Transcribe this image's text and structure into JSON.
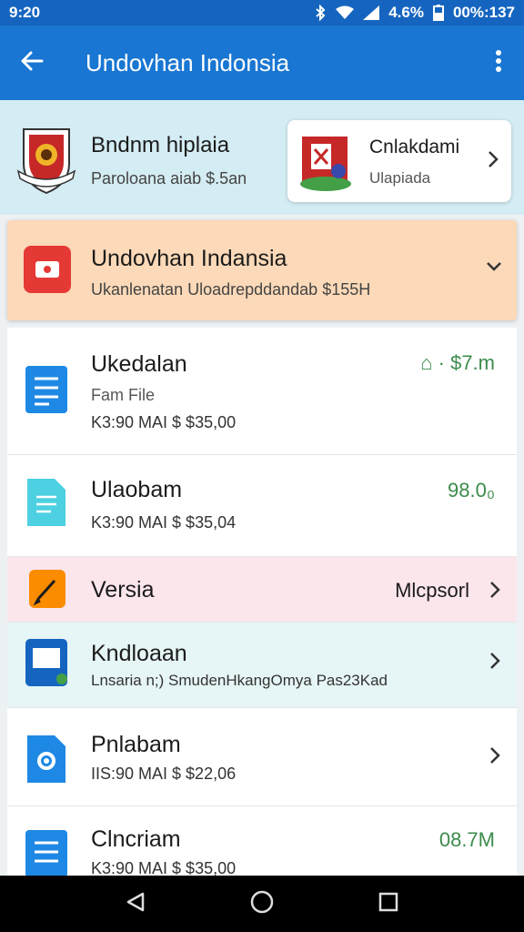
{
  "status": {
    "time": "9:20",
    "battery": "4.6%",
    "extra": "00%:137"
  },
  "app_bar": {
    "title": "Undovhan Indonsia"
  },
  "banner": {
    "title": "Bndnm hiplaia",
    "subtitle": "Paroloana aiab $.5an",
    "chip": {
      "title": "Cnlakdami",
      "subtitle": "Ulapiada"
    }
  },
  "highlight": {
    "title": "Undovhan Indansia",
    "subtitle": "Ukanlenatan Uloadrepddandab $155H"
  },
  "rows": [
    {
      "title": "Ukedalan",
      "sub": "Fam File",
      "sub2": "K3:90 MAI $ $35,00",
      "value": "⌂ · $7.m"
    },
    {
      "title": "Ulaobam",
      "sub": "K3:90 MAI $ $35,04",
      "value": "98.0₀"
    },
    {
      "title": "Versia",
      "value_text": "Mlcpsorl"
    },
    {
      "title": "Kndloaan",
      "sub": "Lnsaria n;) SmudenHkangOmya Pas23Kad"
    },
    {
      "title": "Pnlabam",
      "sub": "IIS:90 MAI $ $22,06"
    },
    {
      "title": "Clncriam",
      "sub": "K3:90 MAI $ $35,00",
      "value": "08.7M"
    }
  ],
  "colors": {
    "primary": "#1976d2",
    "status": "#1565c0",
    "accent_green": "#3c8c4c",
    "highlight": "#fcd9b8",
    "banner": "#d4ecf3",
    "pink_row": "#fbe6ec",
    "teal_row": "#e6f5f5"
  }
}
